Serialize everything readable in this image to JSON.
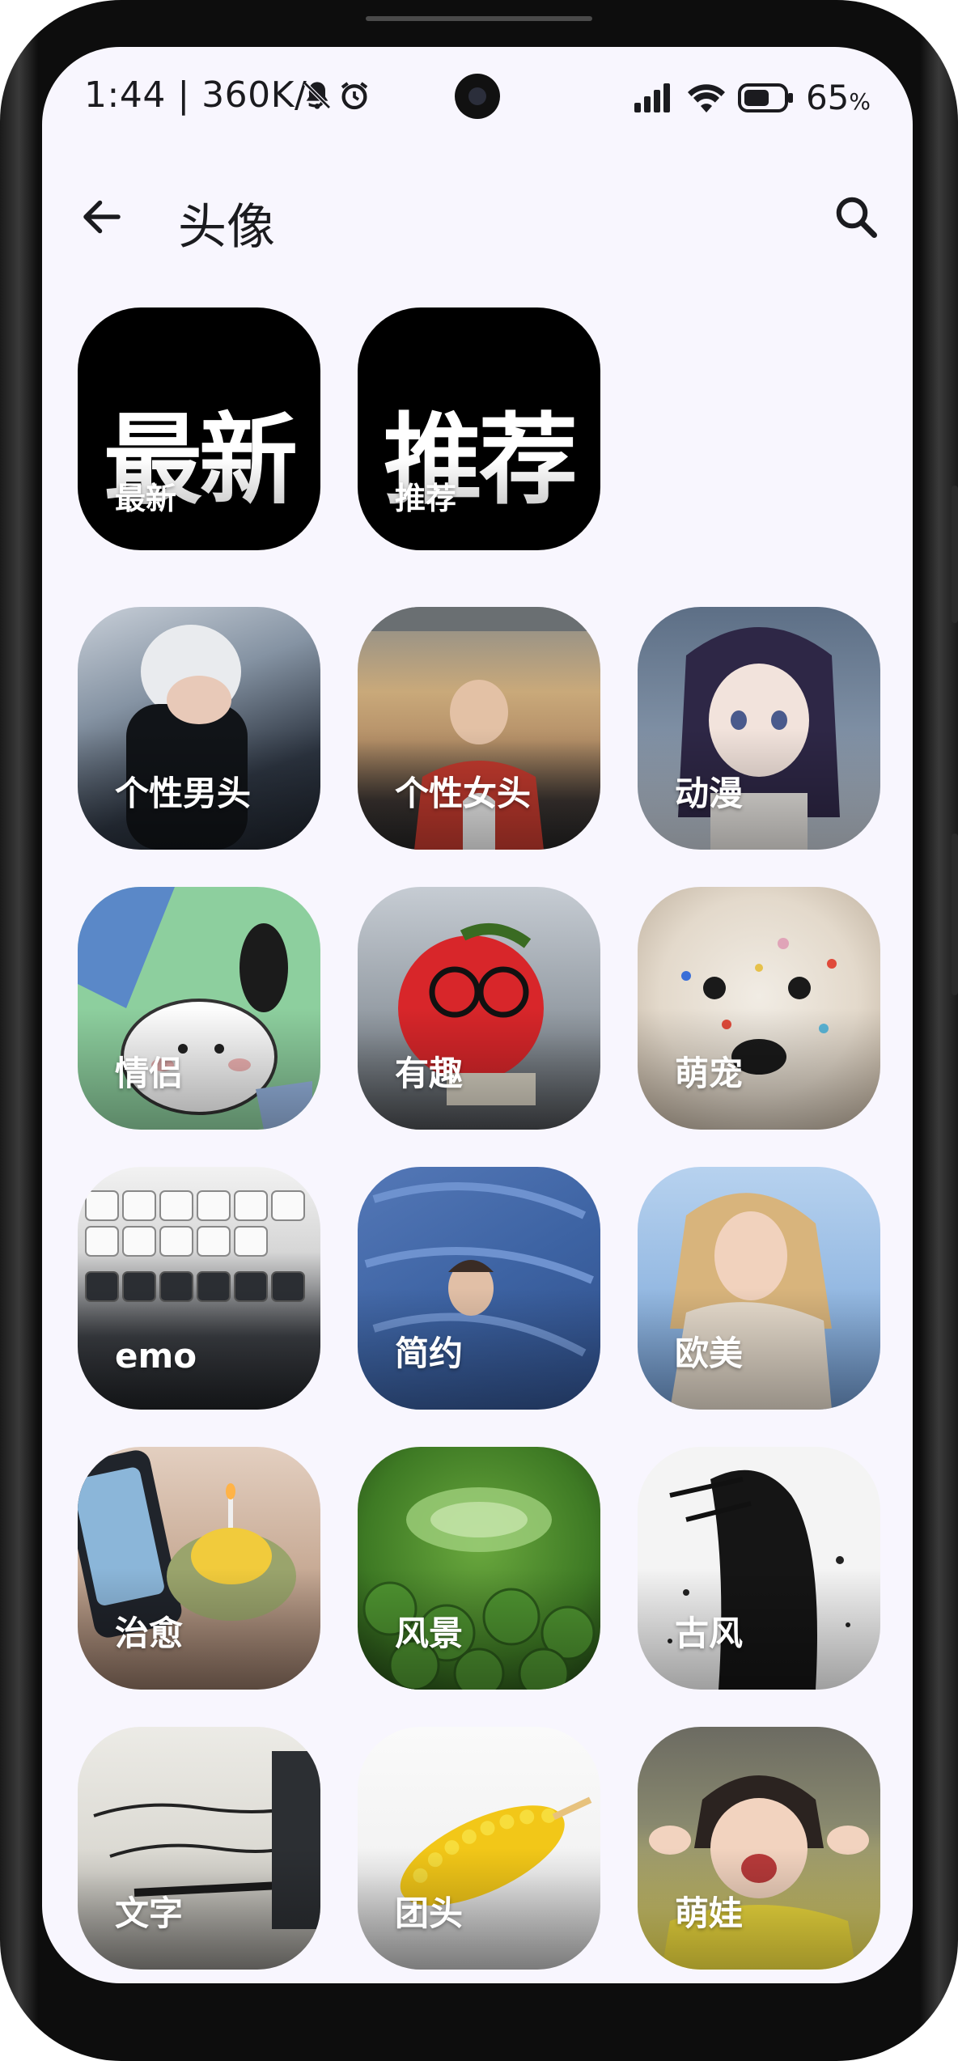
{
  "status_bar": {
    "time": "1:44",
    "speed": "| 360K/s",
    "battery_percent": "65",
    "battery_unit": "%",
    "battery_level": 0.65
  },
  "app_bar": {
    "title": "头像",
    "back_icon": "arrow-left-icon",
    "search_icon": "search-icon"
  },
  "featured": [
    {
      "big": "最新",
      "label": "最新"
    },
    {
      "big": "推荐",
      "label": "推荐"
    }
  ],
  "categories": [
    {
      "label": "个性男头"
    },
    {
      "label": "个性女头"
    },
    {
      "label": "动漫"
    },
    {
      "label": "情侣"
    },
    {
      "label": "有趣"
    },
    {
      "label": "萌宠"
    },
    {
      "label": "emo"
    },
    {
      "label": "简约"
    },
    {
      "label": "欧美"
    },
    {
      "label": "治愈"
    },
    {
      "label": "风景"
    },
    {
      "label": "古风"
    },
    {
      "label": "文字"
    },
    {
      "label": "团头"
    },
    {
      "label": "萌娃"
    }
  ],
  "colors": {
    "screen_bg": "#f8f6fe",
    "text": "#1b1b1f",
    "tile_label": "#ffffff"
  }
}
